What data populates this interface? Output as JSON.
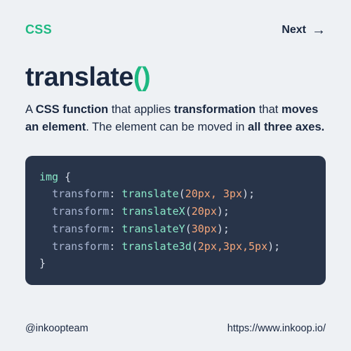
{
  "header": {
    "category": "CSS",
    "next_label": "Next"
  },
  "title": {
    "name": "translate",
    "parens": "()"
  },
  "description": {
    "p1": "A ",
    "b1": "CSS function",
    "p2": " that applies ",
    "b2": "transformation",
    "p3": " that ",
    "b3": "moves an element",
    "p4": ". The element can be moved in ",
    "b4": "all three axes.",
    "p5": ""
  },
  "code": {
    "selector": "img",
    "open": " {",
    "close": "}",
    "lines": [
      {
        "prop": "transform",
        "fn": "translate",
        "args": "20px, 3px"
      },
      {
        "prop": "transform",
        "fn": "translateX",
        "args": "20px"
      },
      {
        "prop": "transform",
        "fn": "translateY",
        "args": "30px"
      },
      {
        "prop": "transform",
        "fn": "translate3d",
        "args": "2px,3px,5px"
      }
    ]
  },
  "footer": {
    "handle": "@inkoopteam",
    "url": "https://www.inkoop.io/"
  }
}
